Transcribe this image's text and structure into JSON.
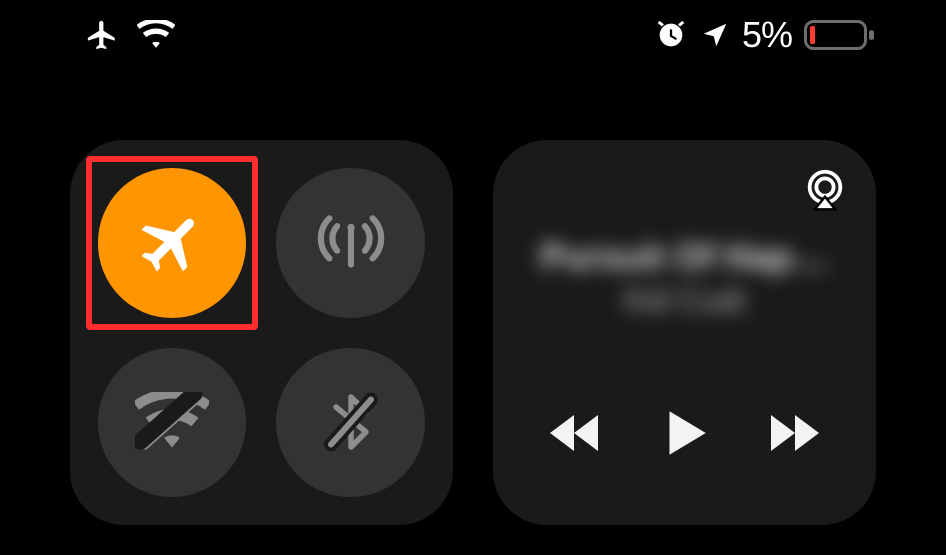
{
  "status_bar": {
    "airplane_mode": true,
    "wifi_connected": true,
    "alarm_set": true,
    "location_active": true,
    "battery_percent_label": "5%",
    "battery_percent_value": 5,
    "battery_low": true
  },
  "connectivity": {
    "airplane_mode": {
      "enabled": true,
      "highlighted": true
    },
    "cellular": {
      "enabled": false
    },
    "wifi": {
      "enabled": false
    },
    "bluetooth": {
      "enabled": false
    }
  },
  "media": {
    "track_title": "Pursuit Of Hap…",
    "track_artist": "Kid Cudi",
    "is_playing": false,
    "airplay_available": true
  },
  "colors": {
    "airplane_active": "#ff9500",
    "highlight_box": "#ff2d2d",
    "battery_low": "#ff3b30"
  }
}
